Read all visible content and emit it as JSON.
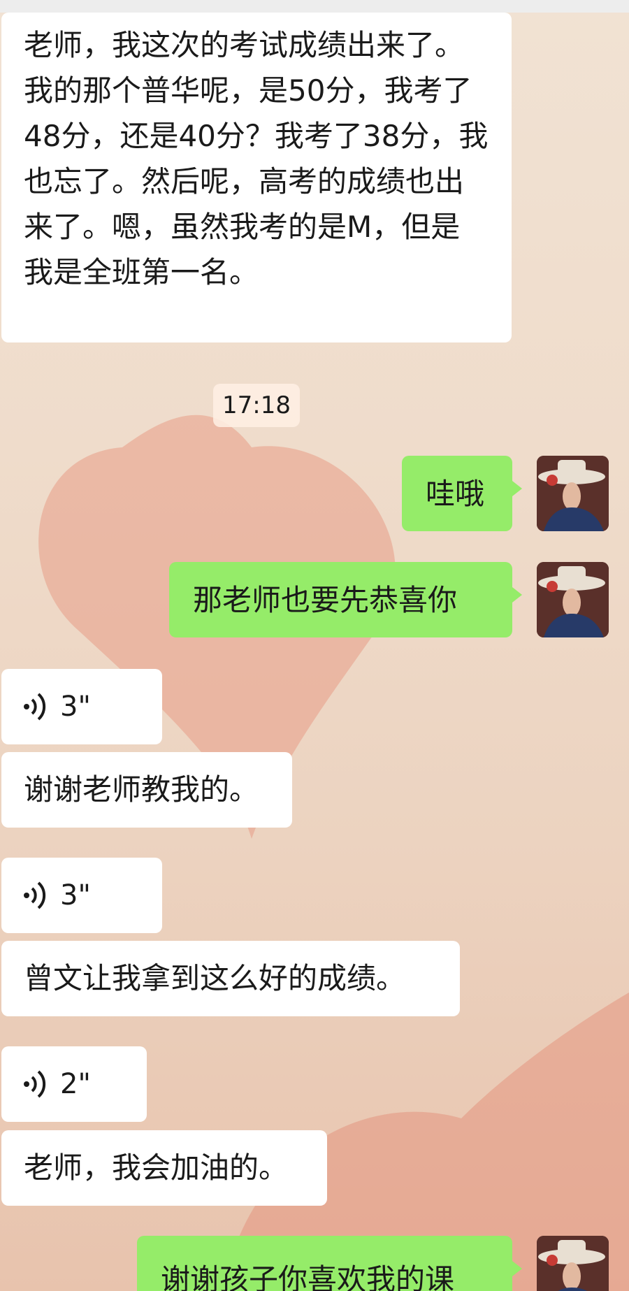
{
  "timestamp": "17:18",
  "messages": [
    {
      "side": "in",
      "type": "text",
      "text": "老师，我这次的考试成绩出来了。我的那个普华呢，是50分，我考了48分，还是40分？我考了38分，我也忘了。然后呢，高考的成绩也出来了。嗯，虽然我考的是M，但是我是全班第一名。"
    },
    {
      "side": "out",
      "type": "text",
      "text": "哇哦"
    },
    {
      "side": "out",
      "type": "text",
      "text": "那老师也要先恭喜你"
    },
    {
      "side": "in",
      "type": "voice",
      "duration": "3\""
    },
    {
      "side": "in",
      "type": "text",
      "text": "谢谢老师教我的。"
    },
    {
      "side": "in",
      "type": "voice",
      "duration": "3\""
    },
    {
      "side": "in",
      "type": "text",
      "text": "曾文让我拿到这么好的成绩。"
    },
    {
      "side": "in",
      "type": "voice",
      "duration": "2\""
    },
    {
      "side": "in",
      "type": "text",
      "text": "老师，我会加油的。"
    },
    {
      "side": "out",
      "type": "text",
      "text": "谢谢孩子你喜欢我的课"
    }
  ],
  "colors": {
    "outgoing_bubble": "#95ec69",
    "incoming_bubble": "#ffffff",
    "heart": "#e59b87"
  },
  "icons": {
    "voice": "voice-wave-icon",
    "avatar": "avatar-cowboy-hat-icon"
  }
}
